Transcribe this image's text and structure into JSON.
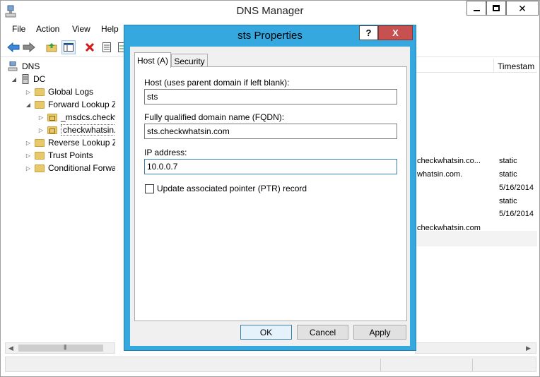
{
  "window": {
    "title": "DNS Manager"
  },
  "menu": [
    "File",
    "Action",
    "View",
    "Help"
  ],
  "tree": [
    {
      "label": "DNS",
      "level": 0
    },
    {
      "label": "DC",
      "level": 1
    },
    {
      "label": "Global Logs",
      "level": 2
    },
    {
      "label": "Forward Lookup Zones",
      "level": 2
    },
    {
      "label": "_msdcs.checkwhatsin.com",
      "level": 3
    },
    {
      "label": "checkwhatsin.com",
      "level": 3
    },
    {
      "label": "Reverse Lookup Zones",
      "level": 2
    },
    {
      "label": "Trust Points",
      "level": 2
    },
    {
      "label": "Conditional Forwarders",
      "level": 2
    }
  ],
  "list": {
    "column_timestamp": "Timestam",
    "rows": [
      {
        "data": "checkwhatsin.co...",
        "timestamp": "static"
      },
      {
        "data": "whatsin.com.",
        "timestamp": "static"
      },
      {
        "data": "",
        "timestamp": "5/16/2014"
      },
      {
        "data": "",
        "timestamp": "static"
      },
      {
        "data": "",
        "timestamp": "5/16/2014"
      },
      {
        "data": "checkwhatsin.com",
        "timestamp": ""
      }
    ]
  },
  "dialog": {
    "title": "sts Properties",
    "help_label": "?",
    "close_label": "X",
    "tabs": [
      "Host (A)",
      "Security"
    ],
    "host_label": "Host (uses parent domain if left blank):",
    "host_value": "sts",
    "fqdn_label": "Fully qualified domain name (FQDN):",
    "fqdn_value": "sts.checkwhatsin.com",
    "ip_label": "IP address:",
    "ip_value": "10.0.0.7",
    "ptr_label": "Update associated pointer (PTR) record",
    "ptr_checked": false,
    "ok_label": "OK",
    "cancel_label": "Cancel",
    "apply_label": "Apply"
  }
}
